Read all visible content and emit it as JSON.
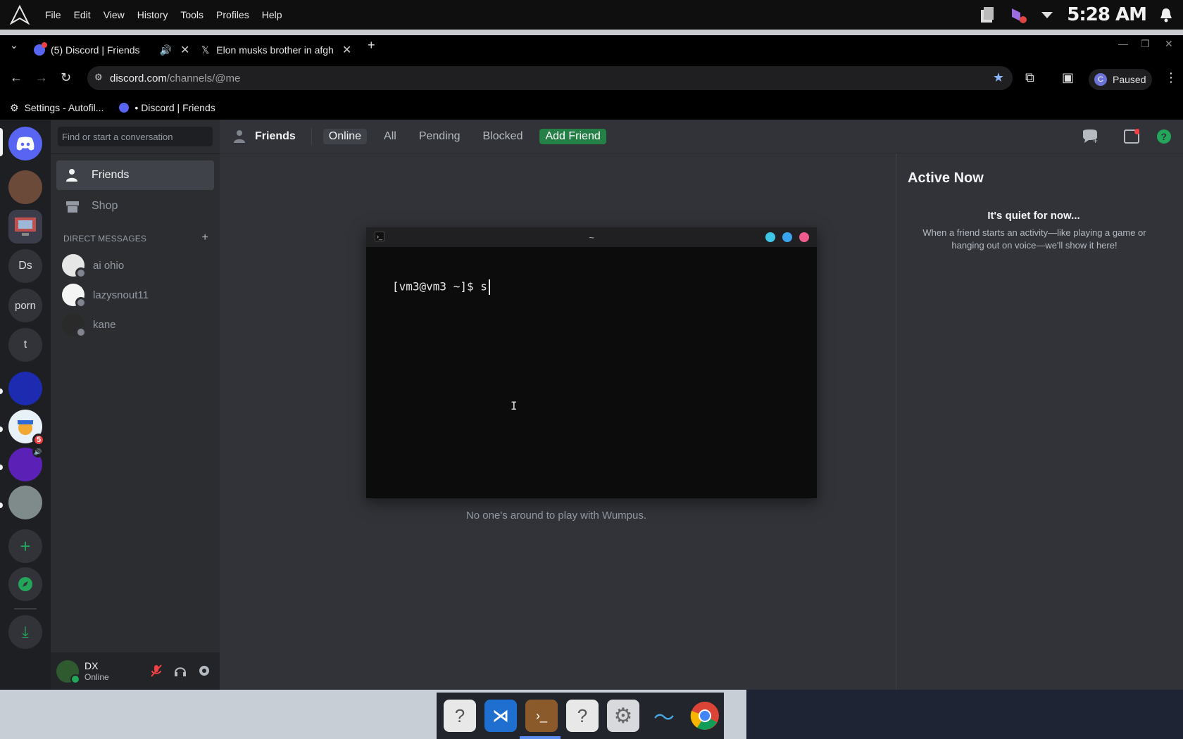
{
  "system": {
    "menus": [
      "File",
      "Edit",
      "View",
      "History",
      "Tools",
      "Profiles",
      "Help"
    ],
    "clock": "5:28 AM"
  },
  "browser": {
    "tabs": [
      {
        "label": "(5) Discord | Friends"
      },
      {
        "label": "Elon musks brother in afgh"
      }
    ],
    "url_host": "discord.com",
    "url_path": "/channels/@me",
    "profile_letter": "C",
    "profile_status": "Paused",
    "bookmarks": [
      "Settings - Autofil...",
      "• Discord | Friends"
    ]
  },
  "discord": {
    "search_placeholder": "Find or start a conversation",
    "servers": [
      "Ds",
      "porn",
      "t"
    ],
    "badge": "5",
    "nav": {
      "friends": "Friends",
      "shop": "Shop"
    },
    "dm_header": "DIRECT MESSAGES",
    "dms": [
      "ai ohio",
      "lazysnout11",
      "kane"
    ],
    "user": {
      "name": "DX",
      "status": "Online"
    },
    "header": {
      "title": "Friends",
      "tabs": [
        "Online",
        "All",
        "Pending",
        "Blocked"
      ],
      "add_friend": "Add Friend"
    },
    "empty_text": "No one's around to play with Wumpus.",
    "active_now": {
      "title": "Active Now",
      "quiet": "It's quiet for now...",
      "desc": "When a friend starts an activity—like playing a game or hanging out on voice—we'll show it here!"
    }
  },
  "terminal": {
    "title": "~",
    "prompt": "[vm3@vm3 ~]$ ",
    "input": "s"
  },
  "colors": {
    "blurple": "#5865f2",
    "green": "#248046",
    "dot_cyan": "#3fc6e6",
    "dot_blue": "#3aa3f0",
    "dot_pink": "#ef5b8c"
  }
}
